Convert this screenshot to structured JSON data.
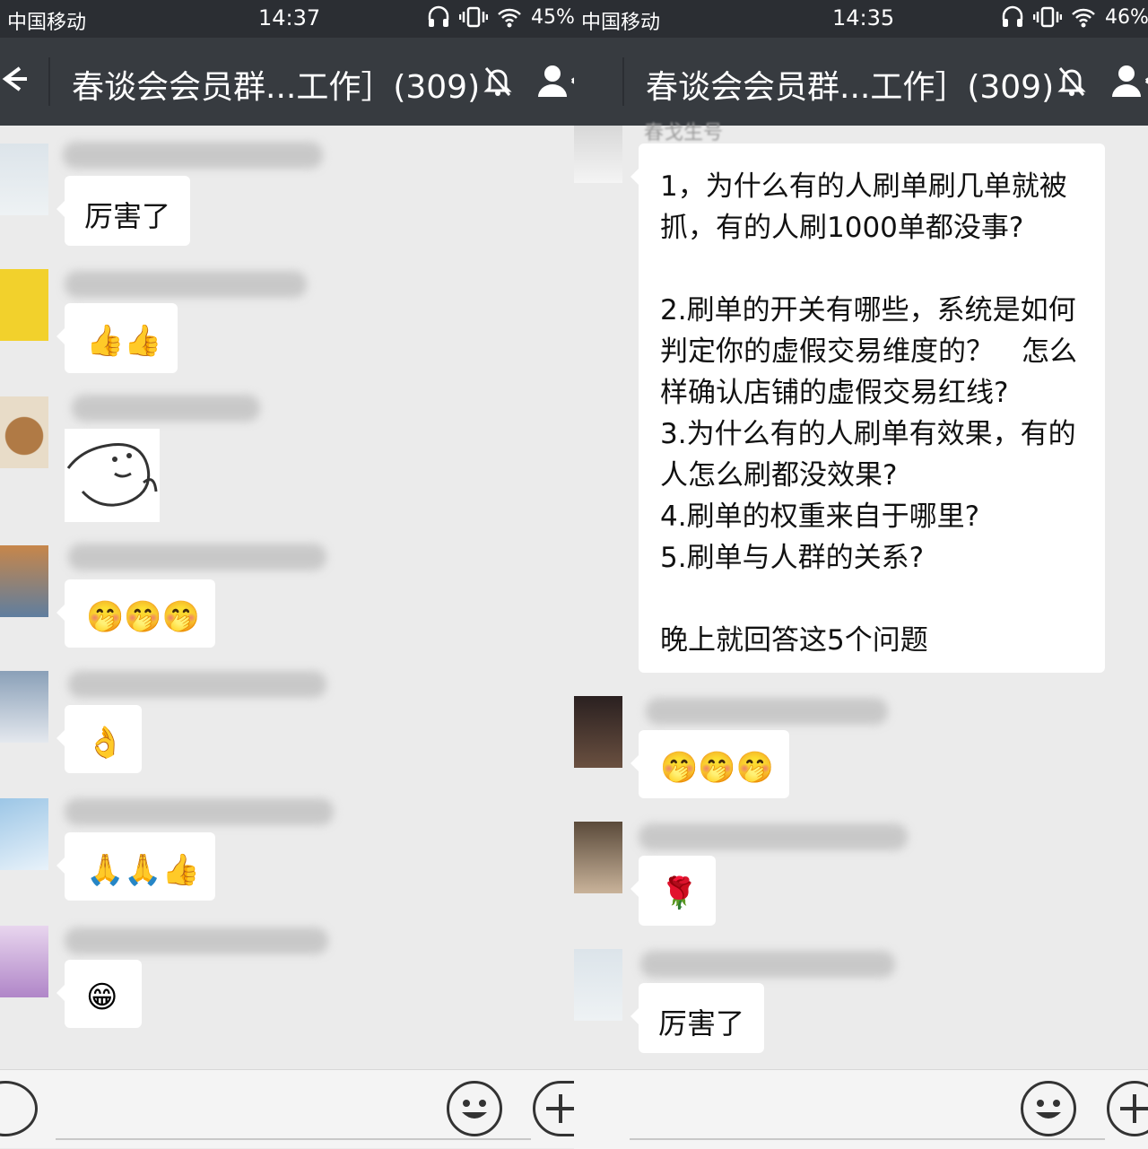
{
  "left": {
    "status": {
      "carrier": "中国移动",
      "time": "14:37",
      "battery": "45%"
    },
    "header": {
      "title": "春谈会会员群...工作］(309)"
    },
    "messages": [
      {
        "text": "厉害了"
      },
      {
        "emoji": "👍👍"
      },
      {
        "sticker": "face-sticker"
      },
      {
        "emoji": "🤭🤭🤭"
      },
      {
        "emoji": "👌"
      },
      {
        "emoji": "🙏🙏👍"
      },
      {
        "emoji": "😁"
      }
    ]
  },
  "right": {
    "status": {
      "carrier": "中国移动",
      "time": "14:35",
      "battery": "46%"
    },
    "header": {
      "title": "春谈会会员群...工作］(309)"
    },
    "partial_name": "春戈生号",
    "long_message": {
      "lines": [
        "1，为什么有的人刷单刷几单就被",
        "抓，有的人刷1000单都没事?",
        "",
        "2.刷单的开关有哪些，系统是如何",
        "判定你的虚假交易维度的？　怎么",
        "样确认店铺的虚假交易红线?",
        "3.为什么有的人刷单有效果，有的",
        "人怎么刷都没效果?",
        "4.刷单的权重来自于哪里?",
        "5.刷单与人群的关系?",
        "",
        "晚上就回答这5个问题"
      ]
    },
    "messages": [
      {
        "emoji": "🤭🤭🤭"
      },
      {
        "emoji": "🌹"
      },
      {
        "text": "厉害了"
      }
    ]
  },
  "colors": {
    "statusbar": "#2b2e33",
    "titlebar": "#373b40",
    "chat_bg": "#ebebeb",
    "bubble": "#ffffff"
  }
}
